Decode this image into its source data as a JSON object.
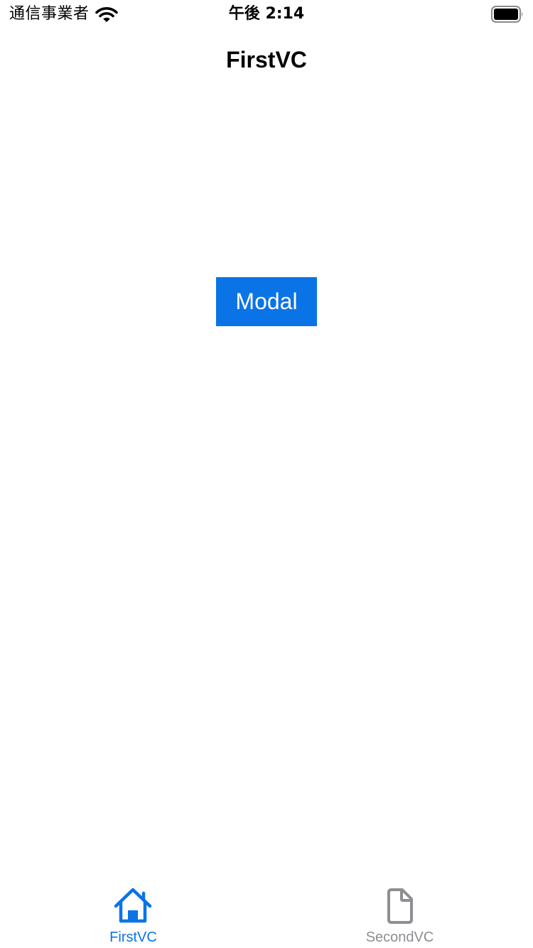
{
  "status_bar": {
    "carrier": "通信事業者",
    "time": "午後 2:14",
    "icons": [
      "wifi-icon",
      "battery-icon"
    ]
  },
  "nav": {
    "title": "FirstVC"
  },
  "main": {
    "modal_button_label": "Modal"
  },
  "tab_bar": {
    "tabs": [
      {
        "label": "FirstVC",
        "icon": "house-icon",
        "selected": true
      },
      {
        "label": "SecondVC",
        "icon": "document-icon",
        "selected": false
      }
    ]
  },
  "colors": {
    "accent": "#0a74e6",
    "inactive": "#8e8e93",
    "background": "#ffffff"
  }
}
